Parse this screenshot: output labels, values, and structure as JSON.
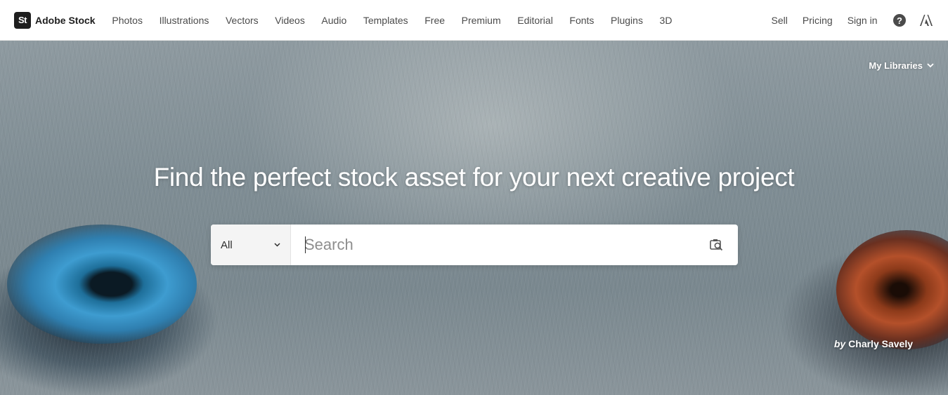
{
  "brand": {
    "logo": "St",
    "name": "Adobe Stock"
  },
  "nav": {
    "links": [
      "Photos",
      "Illustrations",
      "Vectors",
      "Videos",
      "Audio",
      "Templates",
      "Free",
      "Premium",
      "Editorial",
      "Fonts",
      "Plugins",
      "3D"
    ],
    "right": {
      "sell": "Sell",
      "pricing": "Pricing",
      "sign_in": "Sign in",
      "help_icon": "help-icon",
      "adobe_icon": "adobe-icon",
      "help_glyph": "?"
    }
  },
  "hero": {
    "my_libraries": "My Libraries",
    "headline": "Find the perfect stock asset for your next creative project",
    "search": {
      "filter_value": "All",
      "placeholder": "Search",
      "value": ""
    },
    "credit": {
      "by": "by",
      "author": "Charly Savely"
    }
  },
  "colors": {
    "nav_text": "#4b4b4b",
    "brand_dark": "#1e1e1e",
    "hero_text": "#ffffff"
  }
}
